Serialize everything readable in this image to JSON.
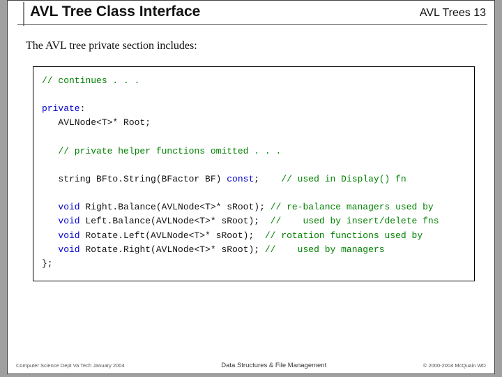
{
  "header": {
    "title": "AVL Tree Class Interface",
    "page_label": "AVL Trees  13"
  },
  "intro": "The AVL tree private section includes:",
  "code": {
    "cont": "// continues . . .",
    "priv_kw": "private",
    "priv_colon": ":",
    "root_decl": "   AVLNode<T>* Root;",
    "helper_cm": "   // private helper functions omitted . . .",
    "bf_ret": "   string BFto.String(BFactor BF) ",
    "const_kw": "const",
    "bf_semi": ";",
    "bf_cm": "    // used in Display() fn",
    "rb_kw": "void",
    "rb": " Right.Balance(AVLNode<T>* sRoot);",
    "rb_cm": " // re-balance managers used by",
    "lb_kw": "void",
    "lb": " Left.Balance(AVLNode<T>* sRoot); ",
    "lb_cm": " //    used by insert/delete fns",
    "rl_kw": "void",
    "rl": " Rotate.Left(AVLNode<T>* sRoot); ",
    "rl_cm": " // rotation functions used by",
    "rr_kw": "void",
    "rr": " Rotate.Right(AVLNode<T>* sRoot);",
    "rr_cm": " //    used by managers",
    "close": "};"
  },
  "footer": {
    "left": "Computer Science Dept Va Tech January 2004",
    "center": "Data Structures & File Management",
    "right": "© 2000-2004  McQuain WD"
  }
}
